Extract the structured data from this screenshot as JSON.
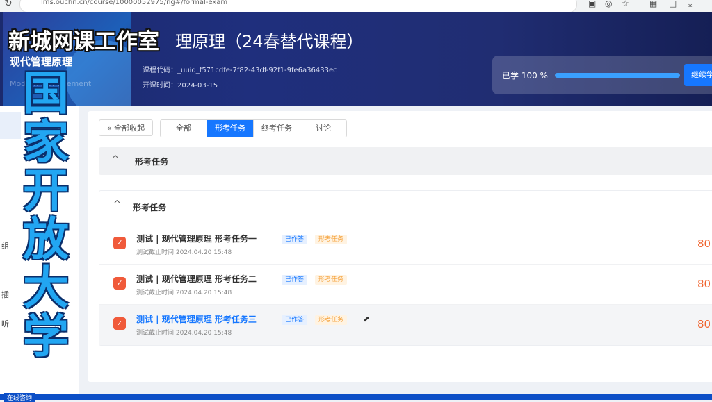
{
  "browser": {
    "url": "lms.ouchn.cn/course/10000052975/ng#/formal-exam"
  },
  "header": {
    "cover_title": "现代管理原理",
    "cover_subtitle": "Modern Management",
    "course_title": "理原理（24春替代课程）",
    "course_code_label": "课程代码：_uuid_f571cdfe-7f82-43df-92f1-9fe6a36433ec",
    "start_date_label": "开课时间：2024-03-15"
  },
  "progress": {
    "label": "已学 100 %",
    "percent": 100,
    "continue_label": "继续学"
  },
  "sidebar": {
    "chars": [
      "组",
      "插",
      "听"
    ]
  },
  "toolbar": {
    "collapse_label": "全部收起",
    "collapse_chevron": "«"
  },
  "tabs": [
    {
      "label": "全部",
      "active": false
    },
    {
      "label": "形考任务",
      "active": true
    },
    {
      "label": "终考任务",
      "active": false
    },
    {
      "label": "讨论",
      "active": false
    }
  ],
  "section": {
    "title": "形考任务",
    "chevron": "^"
  },
  "task_list": {
    "title": "形考任务",
    "chevron": "^",
    "tasks": [
      {
        "title": "测试 | 现代管理原理 形考任务一",
        "status": "已作答",
        "type": "形考任务",
        "deadline": "测试截止时间 2024.04.20 15:48",
        "score": "80"
      },
      {
        "title": "测试 | 现代管理原理 形考任务二",
        "status": "已作答",
        "type": "形考任务",
        "deadline": "测试截止时间 2024.04.20 15:48",
        "score": "80"
      },
      {
        "title": "测试 | 现代管理原理 形考任务三",
        "status": "已作答",
        "type": "形考任务",
        "deadline": "测试截止时间 2024.04.20 15:48",
        "score": "80"
      }
    ]
  },
  "bottom_bar": {
    "label": "在线咨询"
  },
  "overlay": {
    "watermark": "新城网课工作室",
    "vertical_title": "国家开放大学"
  },
  "colors": {
    "accent": "#1677ff",
    "header_bg": "#1f2f7d",
    "score": "#f0642e"
  }
}
